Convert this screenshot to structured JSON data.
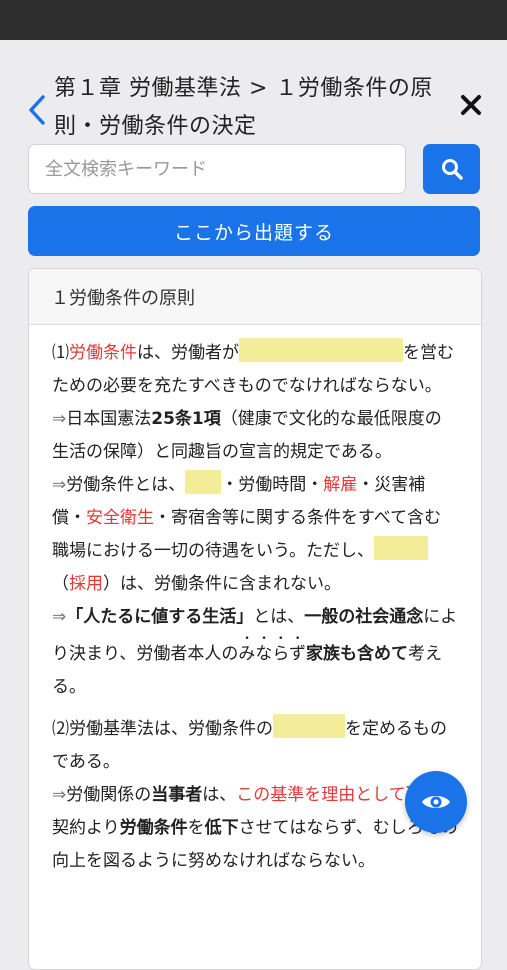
{
  "header": {
    "title": "第１章 労働基準法 > １労働条件の原則・労働条件の決定"
  },
  "search": {
    "placeholder": "全文検索キーワード"
  },
  "start_button": {
    "label": "ここから出題する"
  },
  "section": {
    "heading": "１労働条件の原則",
    "p1": {
      "a": "⑴",
      "b": "労働条件",
      "c": "は、労働者が",
      "d": "を営むための必要を充たすべきものでなければならない。"
    },
    "p1_note": {
      "arrow": "⇒",
      "a": "日本国憲法",
      "b": "25条1項",
      "c": "（健康で文化的な最低限度の生活の保障）と同趣旨の宣言的規定である。"
    },
    "p2": {
      "arrow": "⇒",
      "a": "労働条件とは、",
      "b": "・労働時間・",
      "c": "解雇",
      "d": "・災害補償・",
      "e": "安全衛生",
      "f": "・寄宿舎等に関する条件をすべて含む職場における一切の待遇をいう。",
      "g": "ただし、",
      "h": "（",
      "i": "採用",
      "j": "）は、労働条件に含まれない。"
    },
    "p3": {
      "arrow": "⇒",
      "a": "「人たるに値する生活」",
      "b": "とは、",
      "c": "一般の社会通念",
      "d": "により決まり、労働者本人の",
      "e": "みならず",
      "f": "家族も含めて",
      "g": "考える。"
    },
    "p4": {
      "a": "⑵労働基準法は、労働条件の",
      "b": "を定めるものである。"
    },
    "p5": {
      "arrow": "⇒",
      "a": "労働関係の",
      "b": "当事者",
      "c": "は、",
      "d": "この基準を理由として",
      "e": "現状の契約より",
      "f": "労働条件",
      "g": "を",
      "h": "低下",
      "i": "させてはならず、むしろその向上を図るように努めなければならない。"
    }
  },
  "colors": {
    "accent": "#1a73e8",
    "highlight_red": "#e53935",
    "blank_fill": "#f3ec98"
  },
  "icons": {
    "back": "chevron-left-icon",
    "close": "close-icon",
    "search": "search-icon",
    "toggle": "eye-icon"
  }
}
